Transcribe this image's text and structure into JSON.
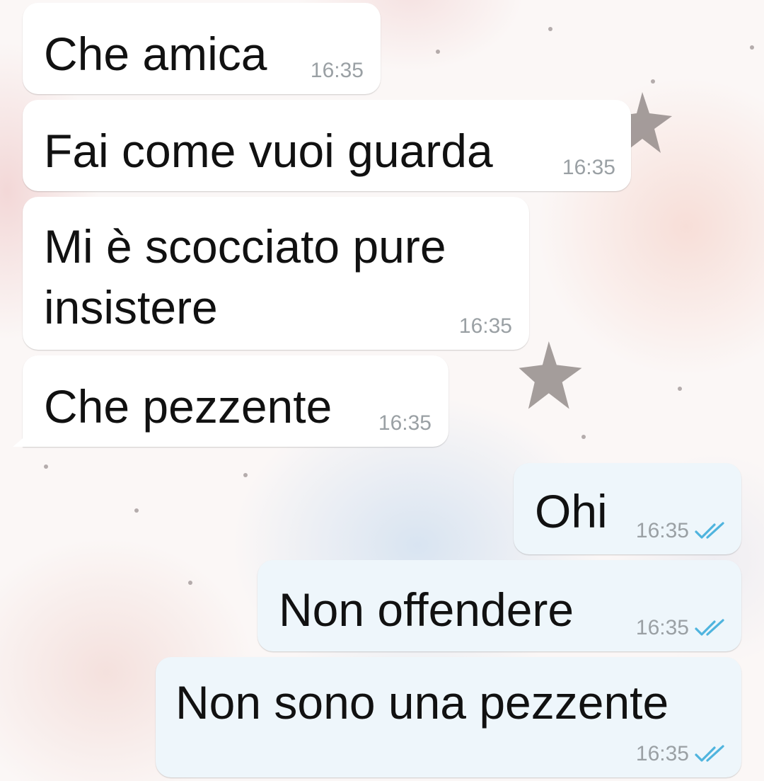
{
  "messages": [
    {
      "id": 1,
      "direction": "incoming",
      "text": "Che amica",
      "time": "16:35"
    },
    {
      "id": 2,
      "direction": "incoming",
      "text": "Fai come vuoi guarda",
      "time": "16:35"
    },
    {
      "id": 3,
      "direction": "incoming",
      "text": [
        "Mi è scocciato pure",
        "insistere"
      ],
      "time": "16:35"
    },
    {
      "id": 4,
      "direction": "incoming",
      "text": "Che pezzente",
      "time": "16:35"
    },
    {
      "id": 5,
      "direction": "outgoing",
      "text": "Ohi",
      "time": "16:35",
      "status_icon": "double-check-icon"
    },
    {
      "id": 6,
      "direction": "outgoing",
      "text": "Non offendere",
      "time": "16:35",
      "status_icon": "double-check-icon"
    },
    {
      "id": 7,
      "direction": "outgoing",
      "text": "Non sono una pezzente",
      "time": "16:35",
      "status_icon": "double-check-icon"
    }
  ],
  "colors": {
    "incoming_bubble": "#ffffff",
    "outgoing_bubble": "#eef6fb",
    "timestamp": "#9aa0a4",
    "read_ticks": "#4fb4de",
    "wallpaper_stars": "#8e8685"
  }
}
